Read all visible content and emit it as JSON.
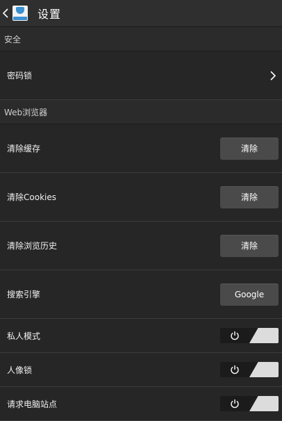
{
  "header": {
    "title": "设置",
    "back_icon": "chevron-left-icon",
    "app_icon": "browser-app-icon"
  },
  "sections": {
    "security": {
      "title": "安全",
      "password_lock_label": "密码锁"
    },
    "web": {
      "title": "Web浏览器",
      "clear_cache_label": "清除缓存",
      "clear_cache_button": "清除",
      "clear_cookies_label": "清除Cookies",
      "clear_cookies_button": "清除",
      "clear_history_label": "清除浏览历史",
      "clear_history_button": "清除",
      "search_engine_label": "搜索引擎",
      "search_engine_value": "Google",
      "private_mode_label": "私人模式",
      "portrait_lock_label": "人像锁",
      "desktop_site_label": "请求电脑站点"
    }
  },
  "toggles": {
    "private_mode": false,
    "portrait_lock": false,
    "desktop_site": false
  },
  "colors": {
    "background": "#262626",
    "button": "#4a4a4a",
    "toggle_track": "#dcdcdc"
  }
}
